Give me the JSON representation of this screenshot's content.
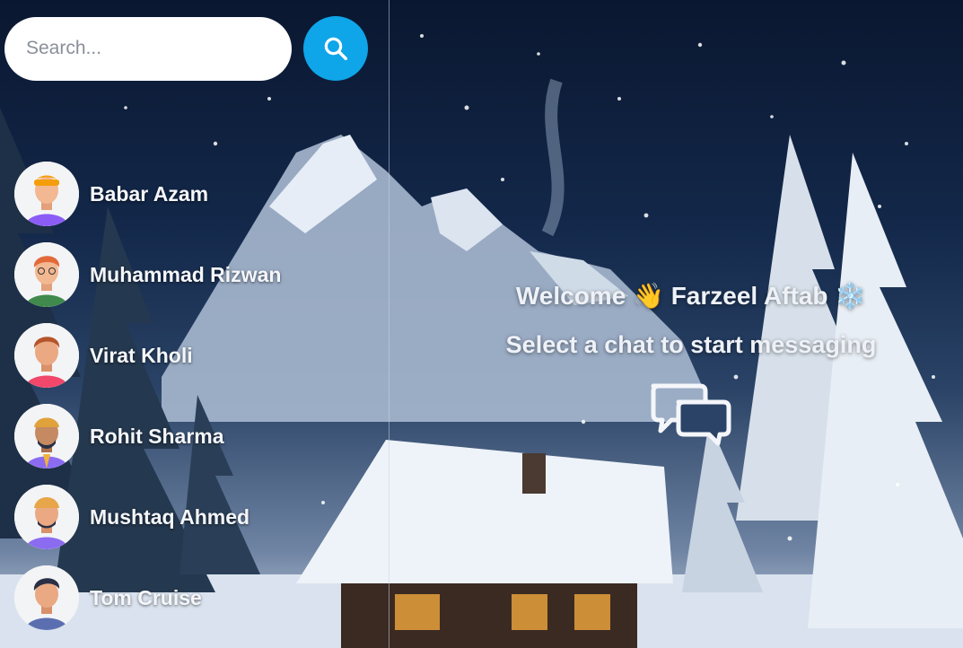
{
  "search": {
    "placeholder": "Search...",
    "icon": "search-icon",
    "button_color": "#0ea5e9"
  },
  "contacts": [
    {
      "name": "Babar Azam",
      "avatar_bg": "#f3f4f6",
      "shirt": "#8b5cf6",
      "hair": "#f59e0b"
    },
    {
      "name": "Muhammad Rizwan",
      "avatar_bg": "#f3f4f6",
      "shirt": "#3f8a4c",
      "hair": "#e26a3a"
    },
    {
      "name": "Virat Kholi",
      "avatar_bg": "#f3f4f6",
      "shirt": "#f0476b",
      "hair": "#b5542b"
    },
    {
      "name": "Rohit Sharma",
      "avatar_bg": "#f3f4f6",
      "shirt": "#8b6cf0",
      "hair": "#e0a23a"
    },
    {
      "name": "Mushtaq Ahmed",
      "avatar_bg": "#f3f4f6",
      "shirt": "#8b6cf0",
      "hair": "#e8a64a"
    },
    {
      "name": "Tom Cruise",
      "avatar_bg": "#f3f4f6",
      "shirt": "#5b6fb0",
      "hair": "#2a2f45"
    }
  ],
  "welcome": {
    "greeting": "Welcome 👋 Farzeel Aftab ❄️",
    "subtitle": "Select a chat to start messaging",
    "icon": "chat-bubbles-icon"
  }
}
